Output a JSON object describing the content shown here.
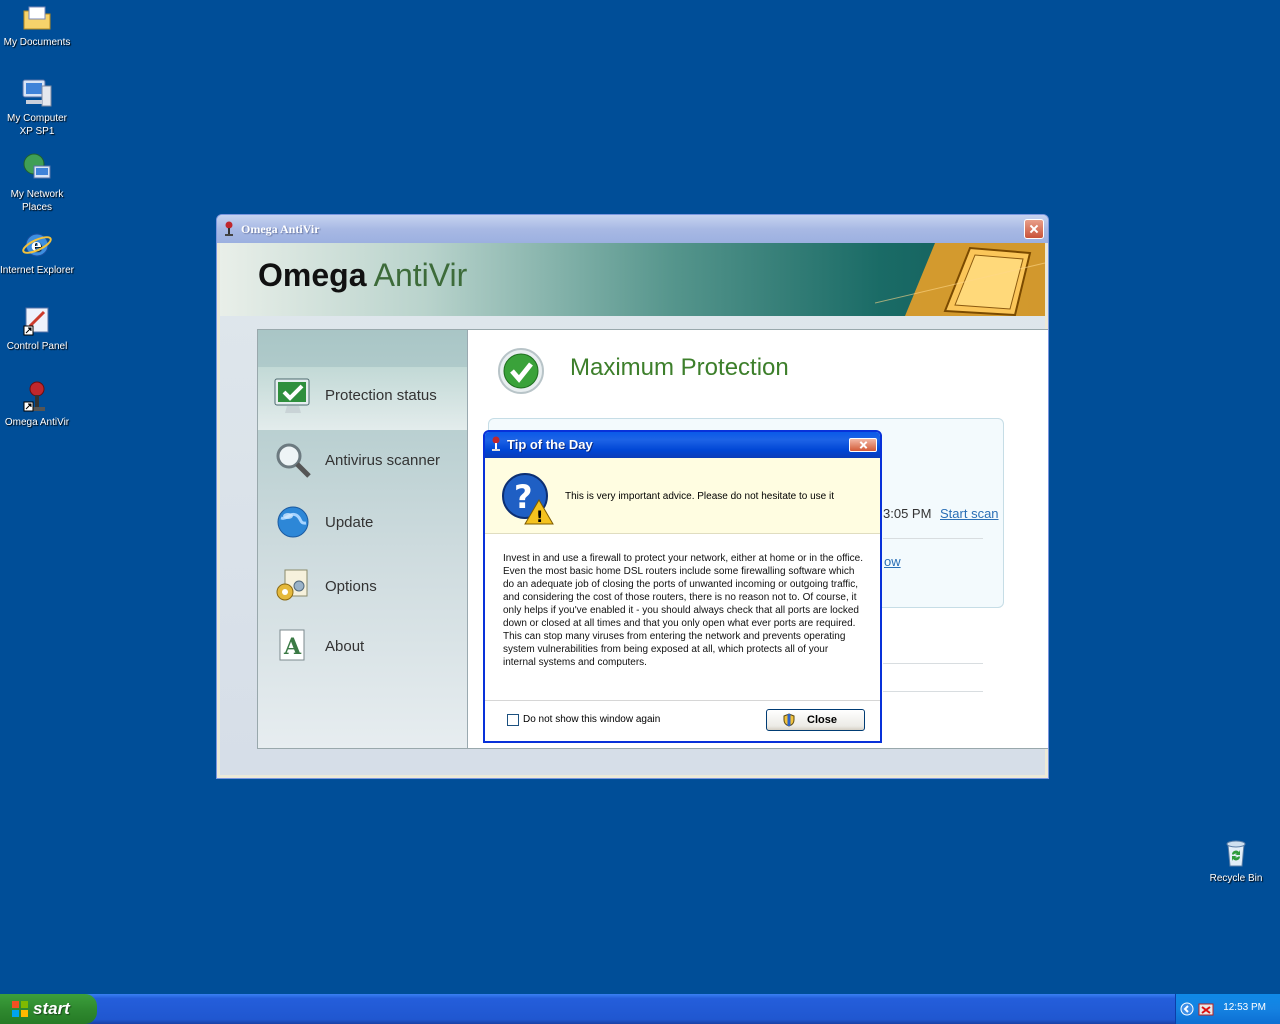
{
  "desktop": {
    "icons": [
      {
        "label": "My Documents"
      },
      {
        "label": "My Computer XP SP1"
      },
      {
        "label": "My Network Places"
      },
      {
        "label": "Internet Explorer"
      },
      {
        "label": "Control Panel"
      },
      {
        "label": "Omega AntiVir"
      },
      {
        "label": "Recycle Bin"
      }
    ]
  },
  "main_window": {
    "title": "Omega AntiVir",
    "brand_part1": "Omega",
    "brand_part2": "AntiVir",
    "sidebar": [
      {
        "label": "Protection status"
      },
      {
        "label": "Antivirus scanner"
      },
      {
        "label": "Update"
      },
      {
        "label": "Options"
      },
      {
        "label": "About"
      }
    ],
    "status_title": "Maximum Protection",
    "scan_time": "3:05 PM",
    "scan_link": "Start scan",
    "now_link": "ow"
  },
  "dialog": {
    "title": "Tip of the Day",
    "header_text": "This is very important advice. Please do not hesitate to use it",
    "body": "Invest in and use a firewall to protect your network, either at home or in the office. Even the most basic home DSL routers include some firewalling software which do an adequate job of closing the ports of unwanted incoming or outgoing traffic, and considering the cost of those routers, there is no reason not to. Of course, it only helps if you've enabled it - you should always check that all ports are locked down or closed at all times and that you only open what ever ports are required. This can stop many viruses from entering the network and prevents operating system vulnerabilities from being exposed at all, which protects all of your internal systems and computers.",
    "checkbox_label": "Do not show this window again",
    "close_label": "Close"
  },
  "taskbar": {
    "start_label": "start",
    "clock": "12:53 PM"
  }
}
